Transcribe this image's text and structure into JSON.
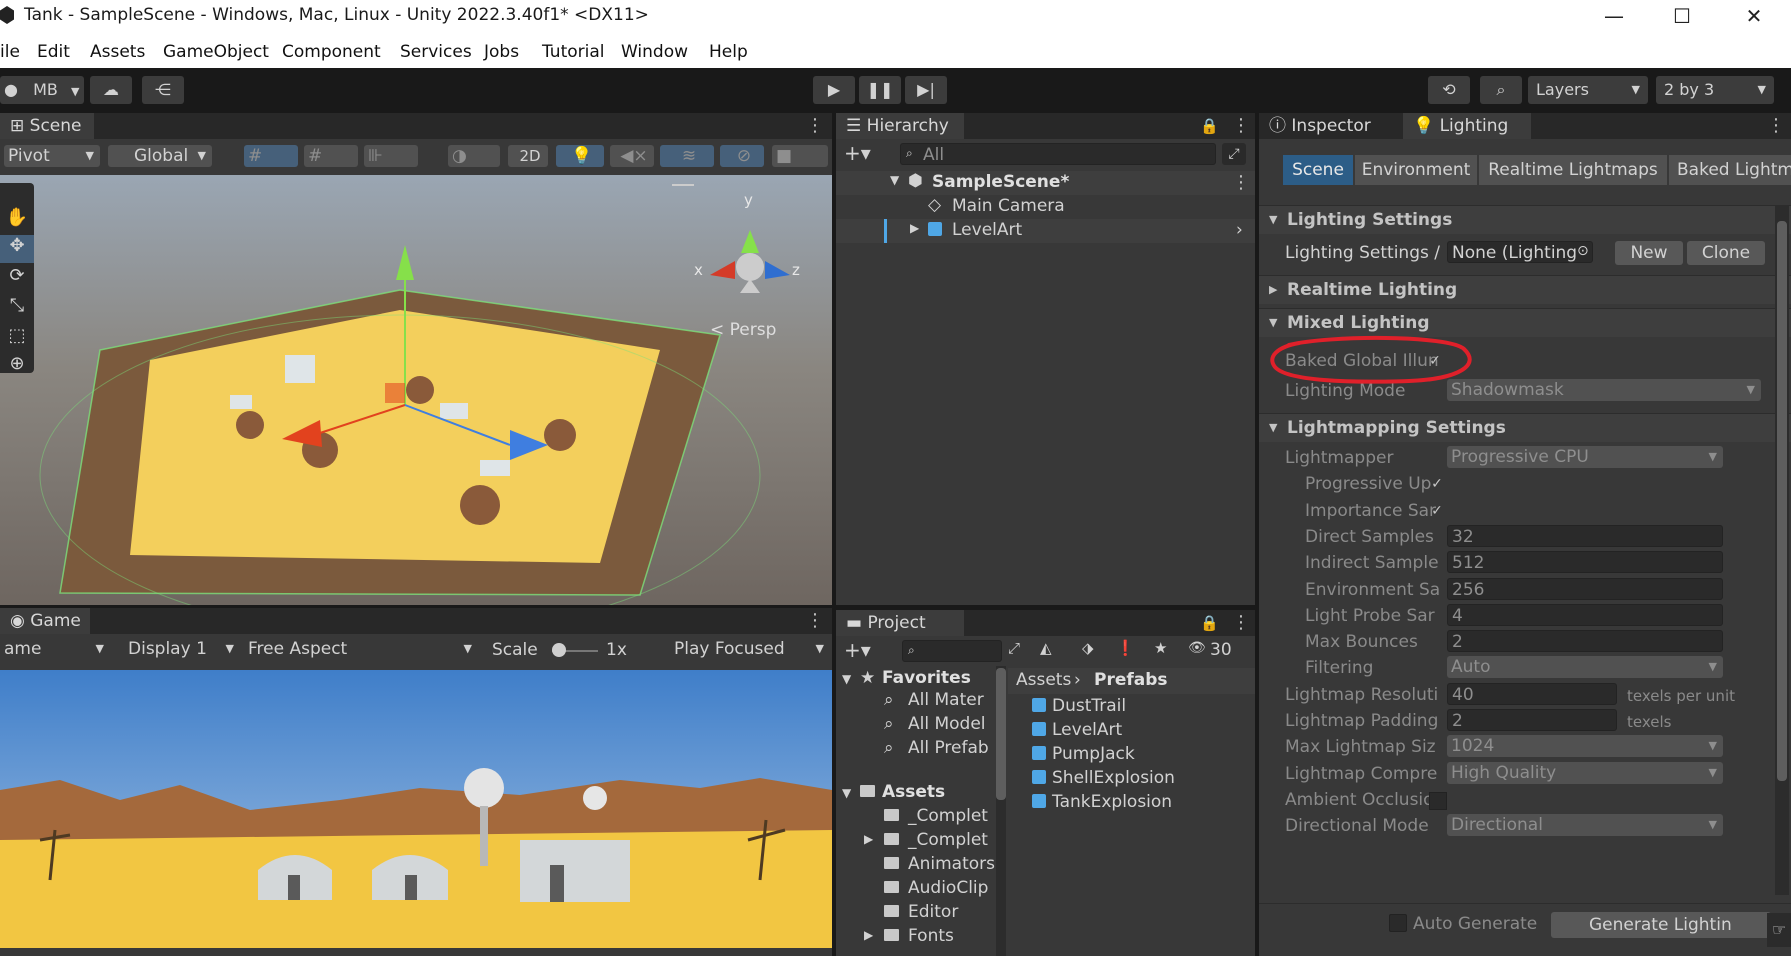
{
  "window": {
    "title": "Tank - SampleScene - Windows, Mac, Linux - Unity 2022.3.40f1* <DX11>",
    "minimize": "—",
    "maximize": "☐",
    "close": "✕"
  },
  "menu": [
    "ile",
    "Edit",
    "Assets",
    "GameObject",
    "Component",
    "Services",
    "Jobs",
    "Tutorial",
    "Window",
    "Help"
  ],
  "toolbar": {
    "account": "MB",
    "layers": "Layers",
    "layout": "2 by 3"
  },
  "scene": {
    "tab": "Scene",
    "pivot": "Pivot",
    "global": "Global",
    "mode2d": "2D",
    "gizmo_axes": {
      "y": "y",
      "x": "x",
      "z": "z"
    },
    "persp": "< Persp"
  },
  "game": {
    "tab": "Game",
    "mode": "ame",
    "display": "Display 1",
    "aspect": "Free Aspect",
    "scale_label": "Scale",
    "scale_value": "1x",
    "play_mode": "Play Focused"
  },
  "hierarchy": {
    "tab": "Hierarchy",
    "search_placeholder": "All",
    "scene": "SampleScene*",
    "items": [
      "Main Camera",
      "LevelArt"
    ]
  },
  "project": {
    "tab": "Project",
    "hidden_count": "30",
    "favorites": {
      "label": "Favorites",
      "items": [
        "All Mater",
        "All Model",
        "All Prefab"
      ]
    },
    "assets": {
      "label": "Assets",
      "items": [
        "_Complet",
        "_Complet",
        "Animators",
        "AudioClip",
        "Editor",
        "Fonts"
      ]
    },
    "breadcrumb": [
      "Assets",
      "Prefabs"
    ],
    "prefabs": [
      "DustTrail",
      "LevelArt",
      "PumpJack",
      "ShellExplosion",
      "TankExplosion"
    ]
  },
  "inspector": {
    "tabs": [
      "Inspector",
      "Lighting"
    ],
    "subtabs": [
      "Scene",
      "Environment",
      "Realtime Lightmaps",
      "Baked Lightm"
    ],
    "lighting_settings": {
      "header": "Lighting Settings",
      "asset_label": "Lighting Settings /",
      "asset_value": "None (Lighting",
      "new_btn": "New",
      "clone_btn": "Clone"
    },
    "realtime_header": "Realtime Lighting",
    "mixed_header": "Mixed Lighting",
    "baked_gi_label": "Baked Global Illun",
    "baked_gi_checked": true,
    "lighting_mode_label": "Lighting Mode",
    "lighting_mode_value": "Shadowmask",
    "lightmapping_header": "Lightmapping Settings",
    "rows": [
      {
        "label": "Lightmapper",
        "value": "Progressive CPU",
        "kind": "dropdown",
        "indent": false
      },
      {
        "label": "Progressive Up",
        "value": "✓",
        "kind": "check",
        "indent": true
      },
      {
        "label": "Importance Sar",
        "value": "✓",
        "kind": "check",
        "indent": true
      },
      {
        "label": "Direct Samples",
        "value": "32",
        "kind": "field",
        "indent": true
      },
      {
        "label": "Indirect Sample",
        "value": "512",
        "kind": "field",
        "indent": true
      },
      {
        "label": "Environment Sa",
        "value": "256",
        "kind": "field",
        "indent": true
      },
      {
        "label": "Light Probe Sar",
        "value": "4",
        "kind": "field",
        "indent": true
      },
      {
        "label": "Max Bounces",
        "value": "2",
        "kind": "field",
        "indent": true
      },
      {
        "label": "Filtering",
        "value": "Auto",
        "kind": "dropdown",
        "indent": true
      },
      {
        "label": "Lightmap Resoluti",
        "value": "40",
        "kind": "field-unit",
        "unit": "texels per unit",
        "indent": false
      },
      {
        "label": "Lightmap Padding",
        "value": "2",
        "kind": "field-unit",
        "unit": "texels",
        "indent": false
      },
      {
        "label": "Max Lightmap Siz",
        "value": "1024",
        "kind": "dropdown",
        "indent": false
      },
      {
        "label": "Lightmap Compre",
        "value": "High Quality",
        "kind": "dropdown",
        "indent": false
      },
      {
        "label": "Ambient Occlusio",
        "value": "",
        "kind": "check",
        "indent": false
      },
      {
        "label": "Directional Mode",
        "value": "Directional",
        "kind": "dropdown",
        "indent": false
      }
    ],
    "auto_generate": "Auto Generate",
    "generate_btn": "Generate Lightin"
  },
  "colors": {
    "annotation": "#e0202a",
    "selected_tab": "#2c5d87",
    "accent": "#4fa7e6"
  }
}
